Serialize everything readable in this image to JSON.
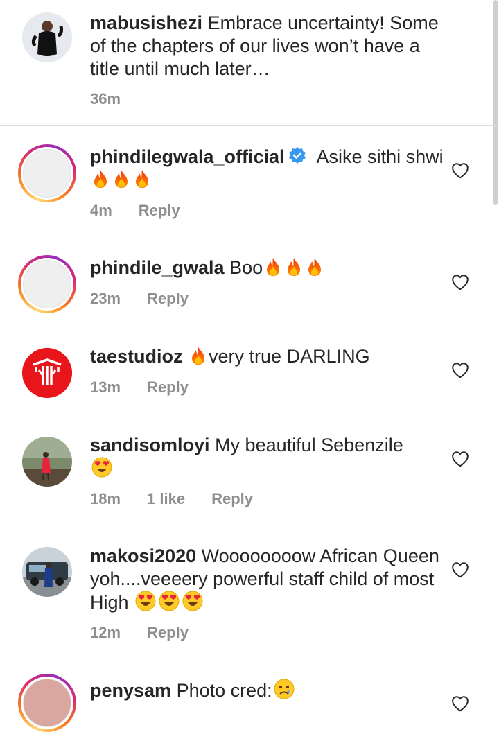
{
  "caption": {
    "username": "mabusishezi",
    "text": "Embrace uncertainty! Some of the chapters of our lives won’t have a title until much later…",
    "time": "36m"
  },
  "comments": [
    {
      "username": "phindilegwala_official",
      "verified": true,
      "text": "Asike sithi shwi",
      "emojis": [
        "fire-icon",
        "fire-icon",
        "fire-icon"
      ],
      "time": "4m",
      "reply": "Reply"
    },
    {
      "username": "phindile_gwala",
      "text": "Boo",
      "emojis": [
        "fire-icon",
        "fire-icon",
        "fire-icon"
      ],
      "time": "23m",
      "reply": "Reply"
    },
    {
      "username": "taestudioz",
      "text": "very true DARLING",
      "emojis_before": [
        "fire-icon"
      ],
      "time": "13m",
      "reply": "Reply"
    },
    {
      "username": "sandisomloyi",
      "text": "My beautiful Sebenzile",
      "emojis": [
        "heart-eyes-icon"
      ],
      "time": "18m",
      "likes": "1 like",
      "reply": "Reply"
    },
    {
      "username": "makosi2020",
      "text": "Woooooooow African Queen yoh....veeeery powerful staff child of most High",
      "emojis": [
        "heart-eyes-icon",
        "heart-eyes-icon",
        "heart-eyes-icon"
      ],
      "time": "12m",
      "reply": "Reply"
    },
    {
      "username": "penysam",
      "text": "Photo cred:",
      "emojis": [
        "crying-face-icon"
      ]
    }
  ],
  "colors": {
    "meta_gray": "#8e8e8e",
    "text": "#262626",
    "verified_blue": "#3897f0",
    "taestudioz_red": "#e8151b"
  }
}
